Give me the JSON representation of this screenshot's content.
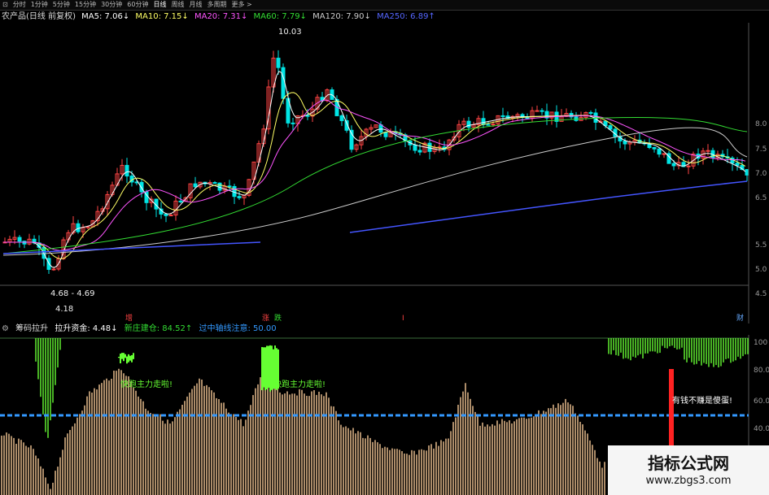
{
  "toolbar": {
    "items": [
      "⊡",
      "分时",
      "1分钟",
      "5分钟",
      "15分钟",
      "30分钟",
      "60分钟",
      "日线",
      "周线",
      "月线",
      "多周期",
      "更多 >"
    ],
    "active_index": 7
  },
  "main_header": {
    "title": "农产品(日线 前复权)",
    "ma": [
      {
        "label": "MA5: 7.06↓",
        "color": "#ffffff"
      },
      {
        "label": "MA10: 7.15↓",
        "color": "#ffff66"
      },
      {
        "label": "MA20: 7.31↓",
        "color": "#ff55ff"
      },
      {
        "label": "MA60: 7.79↓",
        "color": "#33dd33"
      },
      {
        "label": "MA120: 7.90↓",
        "color": "#cccccc"
      },
      {
        "label": "MA250: 6.89↑",
        "color": "#5566ff"
      }
    ]
  },
  "annotations": {
    "high": "10.03",
    "low_range": "4.68 - 4.69",
    "low": "4.18"
  },
  "price_axis": [
    "8.0",
    "7.5",
    "7.0",
    "6.5",
    "5.5",
    "5.0",
    "4.5"
  ],
  "event_markers": [
    {
      "label": "增",
      "color": "#ff4444"
    },
    {
      "label": "涨",
      "color": "#ff4444"
    },
    {
      "label": "跌",
      "color": "#33dd33"
    },
    {
      "label": "I",
      "color": "#ff4444"
    },
    {
      "label": "财",
      "color": "#66aaff"
    }
  ],
  "indicator_header": {
    "name": "筹码拉升",
    "values": [
      {
        "label": "拉升资金: 4.48↓",
        "color": "#ffffff"
      },
      {
        "label": "新庄建仓: 84.52↑",
        "color": "#33dd33"
      },
      {
        "label": "过中轴线注意: 50.00",
        "color": "#3399ff"
      }
    ]
  },
  "indicator_axis": [
    "100",
    "80.00",
    "60.00",
    "40.00"
  ],
  "indicator_notes": [
    "快跑主力走啦!",
    "快跑主力走啦!",
    "有钱不赚是傻蛋!"
  ],
  "watermark": {
    "title": "指标公式网",
    "url": "www.zbgs3.com"
  },
  "colors": {
    "up": "#ff4444",
    "down": "#00e5e5",
    "bar": "#f5c896",
    "warning": "#66ff33",
    "midline": "#3399ff"
  }
}
